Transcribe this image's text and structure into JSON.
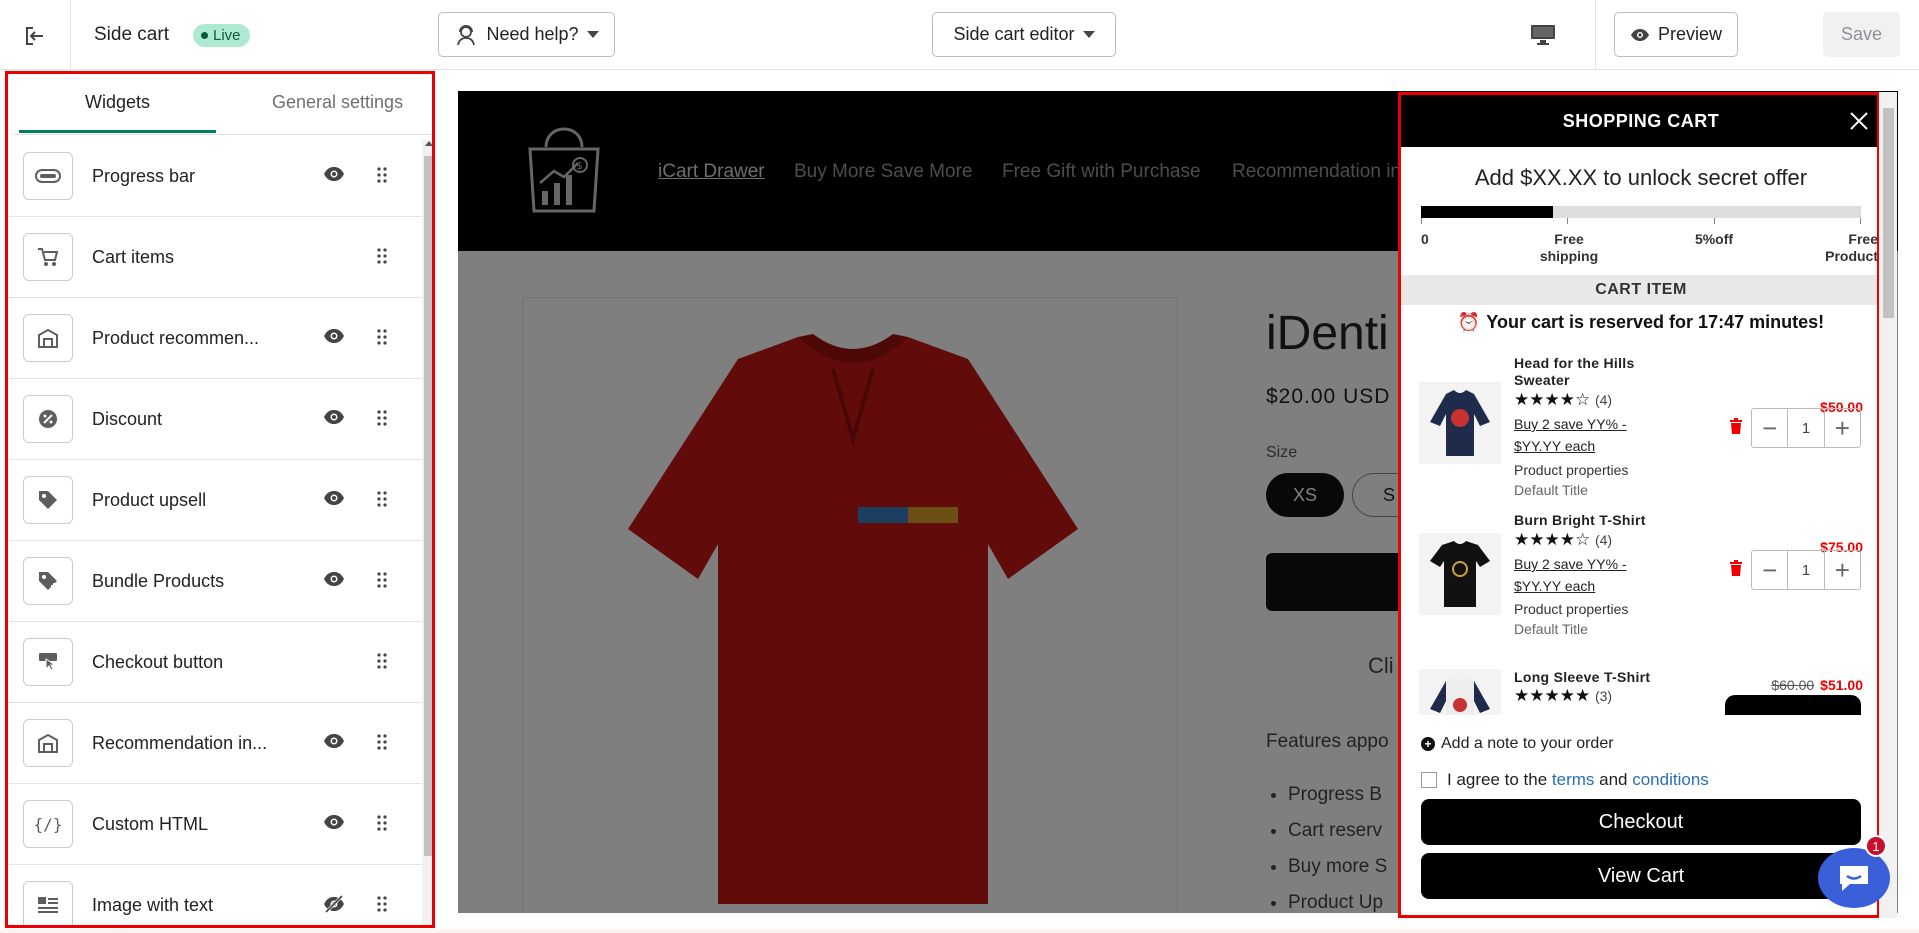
{
  "topbar": {
    "app_title": "Side cart",
    "status_badge": "Live",
    "help_label": "Need help?",
    "editor_label": "Side cart editor",
    "preview_label": "Preview",
    "save_label": "Save"
  },
  "panel": {
    "tabs": [
      "Widgets",
      "General settings"
    ],
    "active_tab": "Widgets",
    "widgets": [
      {
        "label": "Progress bar",
        "icon": "progress-bar-icon",
        "visible": true
      },
      {
        "label": "Cart items",
        "icon": "cart-icon",
        "visible": null
      },
      {
        "label": "Product recommen...",
        "icon": "storefront-icon",
        "visible": true
      },
      {
        "label": "Discount",
        "icon": "discount-icon",
        "visible": true
      },
      {
        "label": "Product upsell",
        "icon": "tag-icon",
        "visible": true
      },
      {
        "label": "Bundle Products",
        "icon": "tag-plus-icon",
        "visible": true
      },
      {
        "label": "Checkout button",
        "icon": "checkout-icon",
        "visible": null
      },
      {
        "label": "Recommendation in...",
        "icon": "storefront-icon",
        "visible": true
      },
      {
        "label": "Custom HTML",
        "icon": "code-icon",
        "visible": true
      },
      {
        "label": "Image with text",
        "icon": "image-text-icon",
        "visible": false
      }
    ]
  },
  "store": {
    "nav": [
      "iCart Drawer",
      "Buy More Save More",
      "Free Gift with Purchase",
      "Recommendation in"
    ],
    "product_title": "iDenti",
    "price": "$20.00 USD",
    "size_label": "Size",
    "sizes": [
      "XS",
      "S"
    ],
    "cli_text": "Cli",
    "features_text": "Features appo",
    "feature_list": [
      "Progress B",
      "Cart reserv",
      "Buy more S",
      "Product Up"
    ]
  },
  "cart": {
    "title": "SHOPPING CART",
    "unlock_text": "Add $XX.XX to unlock secret offer",
    "progress": 0.3,
    "milestones": [
      {
        "label": "0"
      },
      {
        "label": "Free\nshipping"
      },
      {
        "label": "5%off"
      },
      {
        "label": "Free\nProduct"
      }
    ],
    "section_title": "CART ITEM",
    "reserve_text": "Your cart is reserved for 17:47 minutes!",
    "items": [
      {
        "name": "Head for the Hills Sweater",
        "stars": "★★★★☆",
        "reviews": "(4)",
        "offer": "Buy 2 save YY% - $YY.YY each",
        "props": "Product properties",
        "variant": "Default Title",
        "old_price": "",
        "price": "$50.00",
        "qty": "1"
      },
      {
        "name": "Burn Bright T-Shirt",
        "stars": "★★★★☆",
        "reviews": "(4)",
        "offer": "Buy 2 save YY% - $YY.YY each",
        "props": "Product properties",
        "variant": "Default Title",
        "old_price": "",
        "price": "$75.00",
        "qty": "1"
      },
      {
        "name": "Long Sleeve T-Shirt",
        "stars": "★★★★★",
        "reviews": "(3)",
        "offer": "",
        "props": "",
        "variant": "",
        "old_price": "$60.00",
        "price": "$51.00",
        "qty": ""
      }
    ],
    "note_text": "Add a note to your order",
    "agree_prefix": "I agree to the ",
    "agree_terms": "terms",
    "agree_and": " and ",
    "agree_conditions": "conditions",
    "checkout_label": "Checkout",
    "view_cart_label": "View Cart"
  },
  "chat": {
    "badge_count": "1"
  },
  "colors": {
    "accent": "#008060",
    "highlight_border": "#e00000",
    "live_badge": "#aee9d1",
    "price_red": "#e00000",
    "link_blue": "#2a6fb0"
  }
}
